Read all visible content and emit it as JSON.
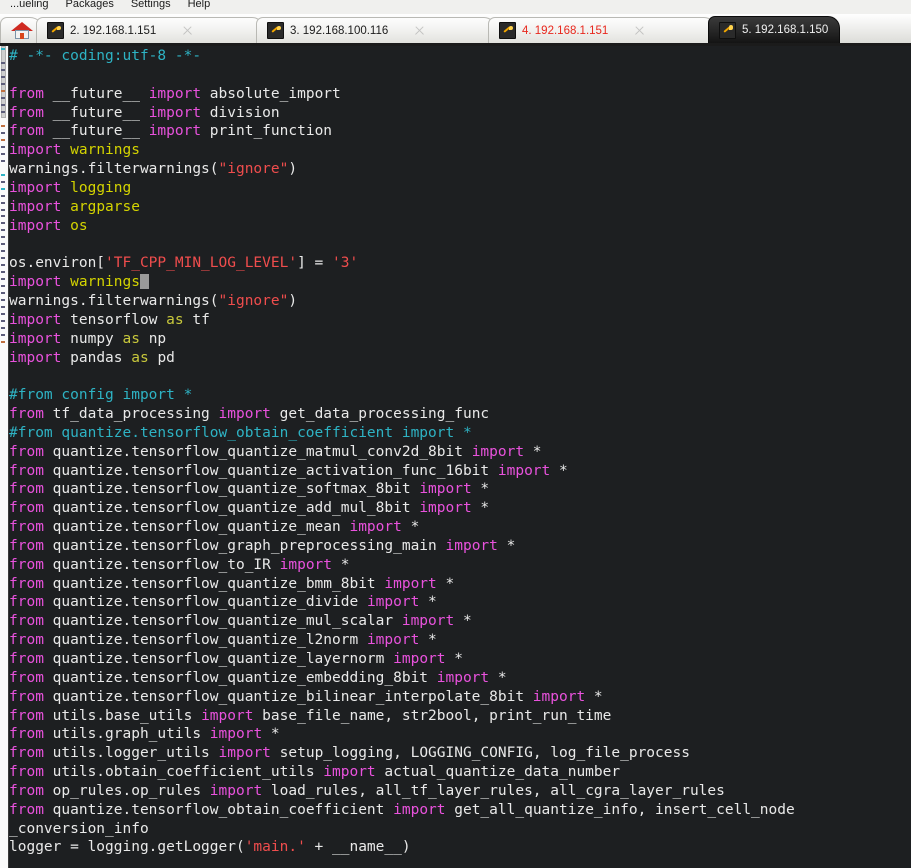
{
  "menubar": {
    "items": [
      "...ueling",
      "Packages",
      "Settings",
      "Help"
    ]
  },
  "tabbar": {
    "home_tab_title": "Home",
    "tabs": [
      {
        "label": "2. 192.168.1.151",
        "icon": "wrench-icon",
        "state": "normal",
        "closable": true
      },
      {
        "label": "3. 192.168.100.116",
        "icon": "wrench-icon",
        "state": "normal",
        "closable": true
      },
      {
        "label": "4. 192.168.1.151",
        "icon": "wrench-icon",
        "state": "alert",
        "closable": true
      },
      {
        "label": "5. 192.168.1.150",
        "icon": "wrench-icon",
        "state": "active",
        "closable": false
      }
    ],
    "alert_color": "#e8271d",
    "active_bg": "#1d1d1d"
  },
  "editor": {
    "language": "python",
    "background": "#1d1f21",
    "cursor_line": 12,
    "colors": {
      "comment": "#2eb3c4",
      "keyword": "#e952dd",
      "string": "#ef4d4d",
      "module": "#d4d400",
      "identifier": "#e9e9e9"
    },
    "lines": [
      {
        "t": "comment",
        "text": "# -*- coding:utf-8 -*-"
      },
      {
        "t": "blank",
        "text": ""
      },
      {
        "t": "from",
        "module": "__future__",
        "names": "absolute_import"
      },
      {
        "t": "from",
        "module": "__future__",
        "names": "division"
      },
      {
        "t": "from",
        "module": "__future__",
        "names": "print_function"
      },
      {
        "t": "import",
        "module": "warnings"
      },
      {
        "t": "code",
        "text": "warnings.filterwarnings(\"ignore\")"
      },
      {
        "t": "import",
        "module": "logging"
      },
      {
        "t": "import",
        "module": "argparse"
      },
      {
        "t": "import",
        "module": "os"
      },
      {
        "t": "blank",
        "text": ""
      },
      {
        "t": "code",
        "text": "os.environ['TF_CPP_MIN_LOG_LEVEL'] = '3'"
      },
      {
        "t": "import",
        "module": "warnings",
        "cursor": true
      },
      {
        "t": "code",
        "text": "warnings.filterwarnings(\"ignore\")"
      },
      {
        "t": "import_as",
        "module": "tensorflow",
        "alias": "tf"
      },
      {
        "t": "import_as",
        "module": "numpy",
        "alias": "np"
      },
      {
        "t": "import_as",
        "module": "pandas",
        "alias": "pd"
      },
      {
        "t": "blank",
        "text": ""
      },
      {
        "t": "comment",
        "text": "#from config import *"
      },
      {
        "t": "from",
        "module": "tf_data_processing",
        "names": "get_data_processing_func"
      },
      {
        "t": "comment",
        "text": "#from quantize.tensorflow_obtain_coefficient import *"
      },
      {
        "t": "from",
        "module": "quantize.tensorflow_quantize_matmul_conv2d_8bit",
        "names": "*"
      },
      {
        "t": "from",
        "module": "quantize.tensorflow_quantize_activation_func_16bit",
        "names": "*"
      },
      {
        "t": "from",
        "module": "quantize.tensorflow_quantize_softmax_8bit",
        "names": "*"
      },
      {
        "t": "from",
        "module": "quantize.tensorflow_quantize_add_mul_8bit",
        "names": "*"
      },
      {
        "t": "from",
        "module": "quantize.tensorflow_quantize_mean",
        "names": "*"
      },
      {
        "t": "from",
        "module": "quantize.tensorflow_graph_preprocessing_main",
        "names": "*"
      },
      {
        "t": "from",
        "module": "quantize.tensorflow_to_IR",
        "names": "*"
      },
      {
        "t": "from",
        "module": "quantize.tensorflow_quantize_bmm_8bit",
        "names": "*"
      },
      {
        "t": "from",
        "module": "quantize.tensorflow_quantize_divide",
        "names": "*"
      },
      {
        "t": "from",
        "module": "quantize.tensorflow_quantize_mul_scalar",
        "names": "*"
      },
      {
        "t": "from",
        "module": "quantize.tensorflow_quantize_l2norm",
        "names": "*"
      },
      {
        "t": "from",
        "module": "quantize.tensorflow_quantize_layernorm",
        "names": "*"
      },
      {
        "t": "from",
        "module": "quantize.tensorflow_quantize_embedding_8bit",
        "names": "*"
      },
      {
        "t": "from",
        "module": "quantize.tensorflow_quantize_bilinear_interpolate_8bit",
        "names": "*"
      },
      {
        "t": "from",
        "module": "utils.base_utils",
        "names": "base_file_name, str2bool, print_run_time"
      },
      {
        "t": "from",
        "module": "utils.graph_utils",
        "names": "*"
      },
      {
        "t": "from",
        "module": "utils.logger_utils",
        "names": "setup_logging, LOGGING_CONFIG, log_file_process"
      },
      {
        "t": "from",
        "module": "utils.obtain_coefficient_utils",
        "names": "actual_quantize_data_number"
      },
      {
        "t": "from",
        "module": "op_rules.op_rules",
        "names": "load_rules, all_tf_layer_rules, all_cgra_layer_rules"
      },
      {
        "t": "from",
        "module": "quantize.tensorflow_obtain_coefficient",
        "names": "get_all_quantize_info, insert_cell_node"
      },
      {
        "t": "cont",
        "text": "_conversion_info"
      },
      {
        "t": "code",
        "text": "logger = logging.getLogger('main.' + __name__)"
      }
    ]
  }
}
